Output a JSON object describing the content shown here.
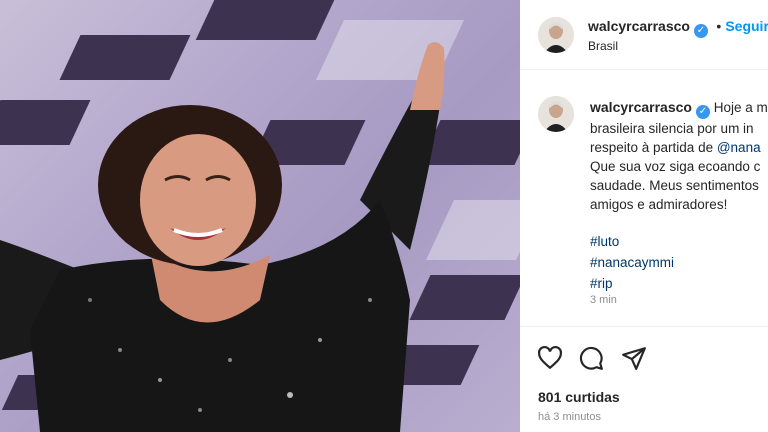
{
  "post": {
    "username": "walcyrcarrasco",
    "follow_label": "Seguir",
    "location": "Brasil",
    "caption_lines": [
      "Hoje a m",
      "brasileira silencia por um in",
      "respeito à partida de ",
      "Que sua voz siga ecoando c",
      "saudade. Meus sentimentos",
      "amigos e admiradores!"
    ],
    "mention": "@nana",
    "hashtags": [
      "#luto",
      "#nanacaymmi",
      "#rip"
    ],
    "comment_time": "3 min",
    "likes": "801 curtidas",
    "posted_time": "há 3 minutos",
    "dot_separator": "•"
  },
  "icons": {
    "like": "heart-icon",
    "comment": "comment-icon",
    "share": "share-icon",
    "verified": "verified-badge-icon"
  },
  "colors": {
    "link": "#0095f6",
    "hashtag": "#00376b",
    "verified": "#3897f0"
  }
}
